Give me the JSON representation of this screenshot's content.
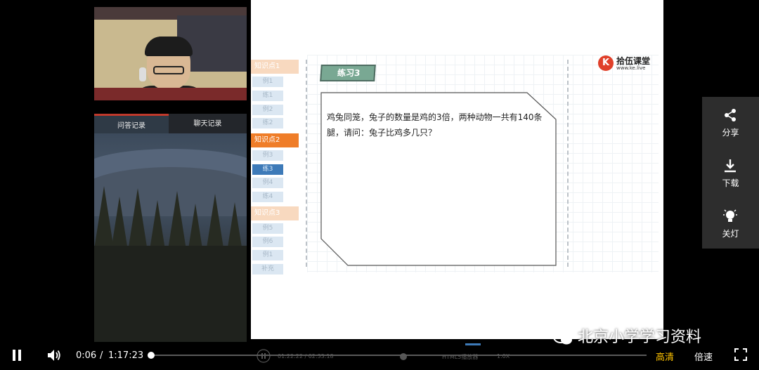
{
  "sidebar": {
    "tabs": [
      {
        "label": "问答记录"
      },
      {
        "label": "聊天记录"
      }
    ]
  },
  "slide": {
    "outline": [
      {
        "label": "知识点1",
        "kind": "section"
      },
      {
        "label": "例1",
        "kind": "item"
      },
      {
        "label": "练1",
        "kind": "item"
      },
      {
        "label": "例2",
        "kind": "item"
      },
      {
        "label": "练2",
        "kind": "item"
      },
      {
        "label": "知识点2",
        "kind": "section-active"
      },
      {
        "label": "例3",
        "kind": "item"
      },
      {
        "label": "练3",
        "kind": "item-active"
      },
      {
        "label": "例4",
        "kind": "item"
      },
      {
        "label": "练4",
        "kind": "item"
      },
      {
        "label": "知识点3",
        "kind": "section"
      },
      {
        "label": "例5",
        "kind": "item"
      },
      {
        "label": "例6",
        "kind": "item"
      },
      {
        "label": "例1",
        "kind": "item"
      },
      {
        "label": "补充",
        "kind": "item"
      }
    ],
    "exercise_tag": "练习3",
    "logo": {
      "mark": "K",
      "name": "拾伍课堂",
      "url": "www.ke.live"
    },
    "question_line1": "鸡兔同笼，兔子的数量是鸡的3倍，两种动物一共有140条",
    "question_line2": "腿，请问：兔子比鸡多几只？"
  },
  "inner_player": {
    "time": "01:22:22 / 02:33:18",
    "label": "HTML5播放器",
    "speed": "1.0X"
  },
  "share_panel": {
    "share": "分享",
    "download": "下载",
    "lights_off": "关灯"
  },
  "player": {
    "current_time": "0:06",
    "separator": "/",
    "total_time": "1:17:23",
    "progress": 0.0013,
    "quality": "高清",
    "speed": "倍速"
  },
  "watermark": "北京小学学习资料",
  "colors": {
    "accent_orange": "#ef7d28",
    "active_blue": "#3d7ab8",
    "quality_yellow": "#ffc300"
  }
}
